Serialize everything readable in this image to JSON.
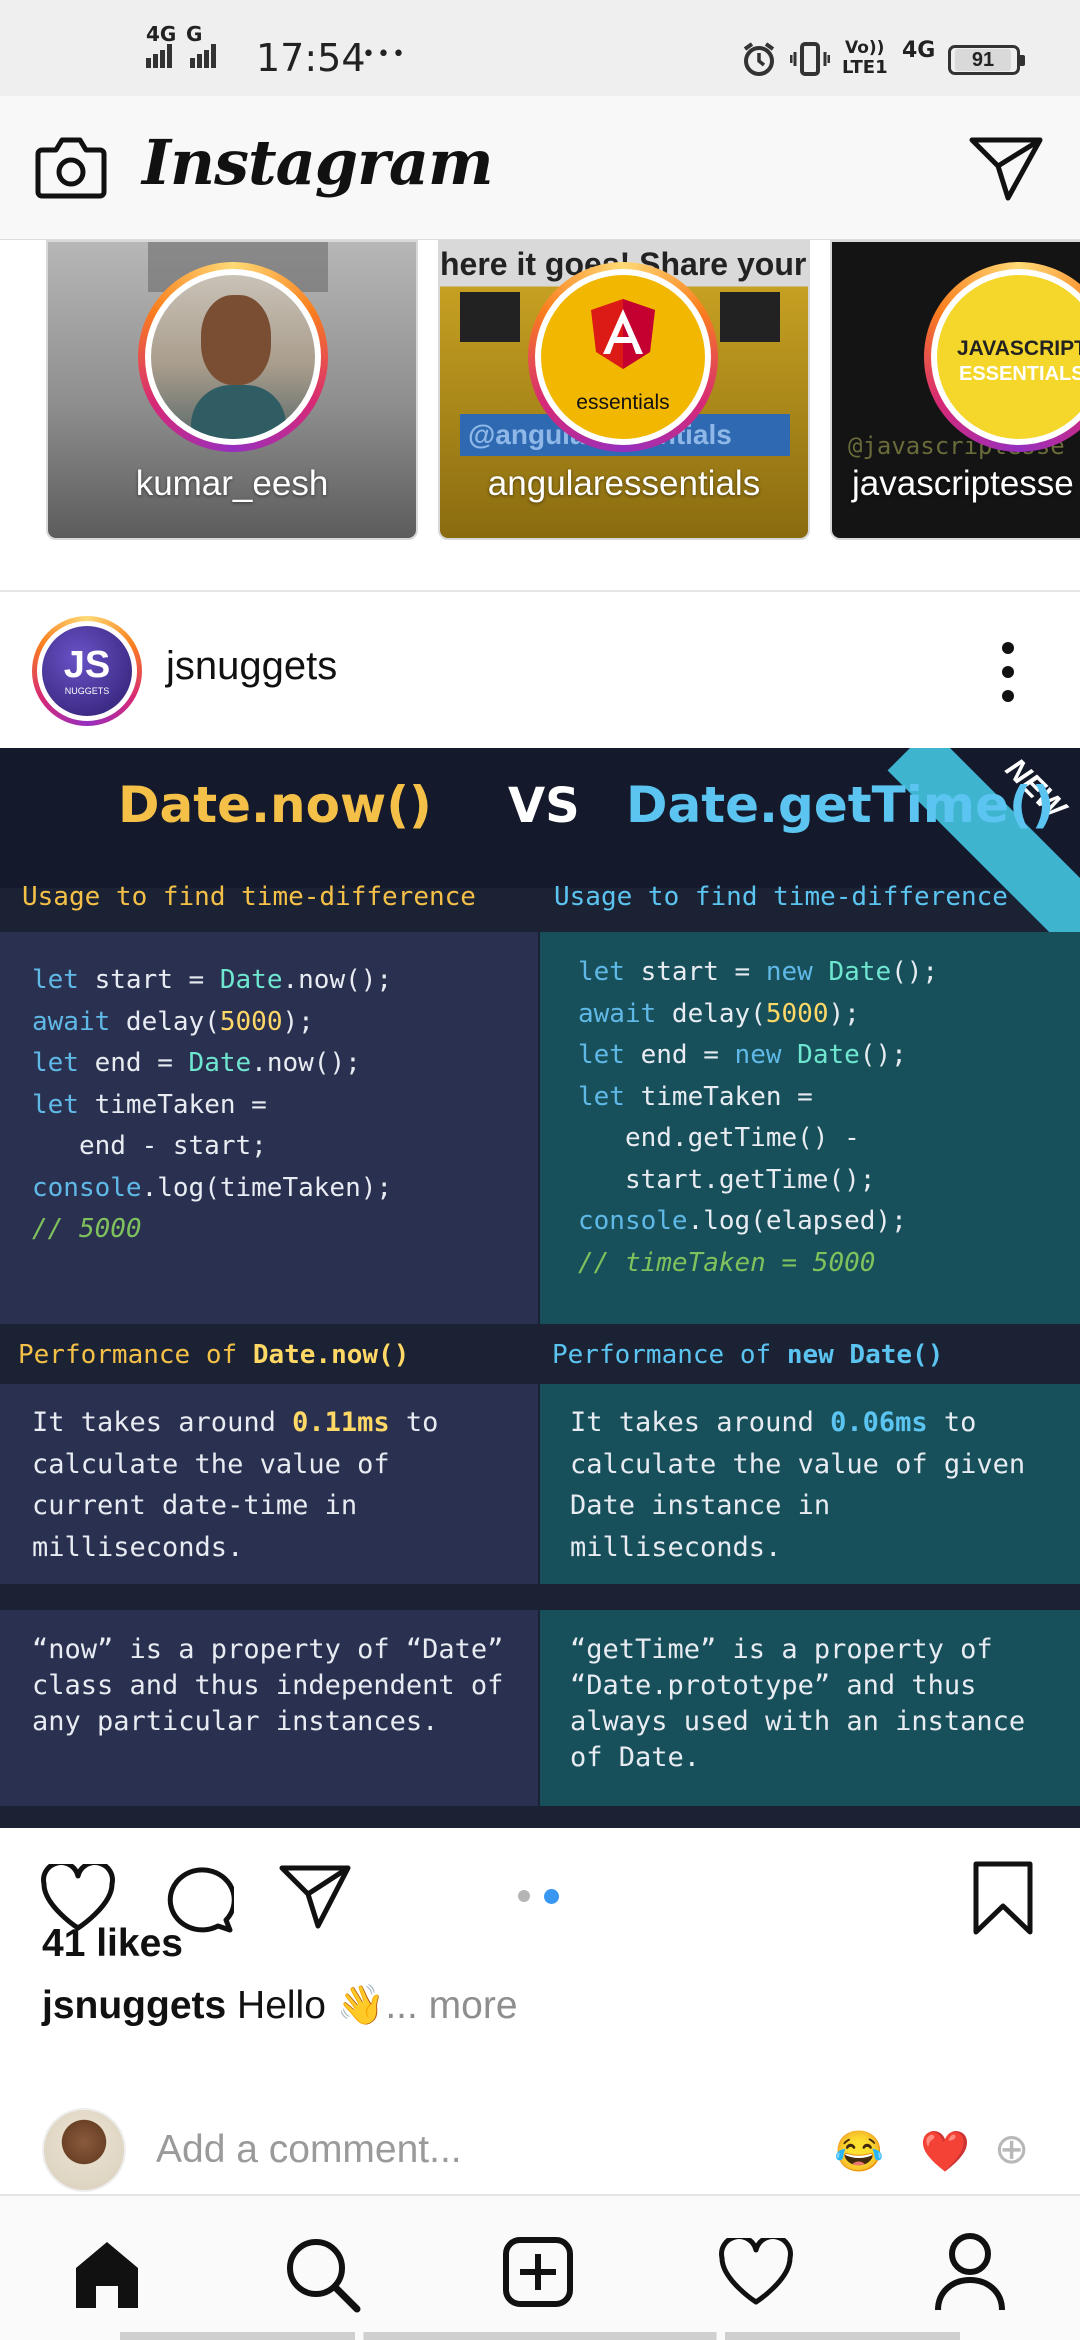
{
  "status_bar": {
    "net1": "4G",
    "net2": "G",
    "time": "17:54",
    "dots": "•••",
    "volte": "Vo))",
    "lte": "LTE1",
    "net3": "4G",
    "battery": "91"
  },
  "header": {
    "logo_text": "Instagram"
  },
  "stories": [
    {
      "name": "kumar_eesh"
    },
    {
      "name": "angularessentials",
      "avatar_text": "essentials",
      "banner_text": "here it goes! Share your",
      "handle_text": "@angularessentials"
    },
    {
      "name": "javascriptesse",
      "avatar_text_1": "JAVASCRIPT",
      "avatar_text_2": "ESSENTIALS",
      "handle_text": "@javascriptesse"
    }
  ],
  "post": {
    "username": "jsnuggets",
    "avatar_text_1": "JS",
    "avatar_text_2": "NUGGETS",
    "image": {
      "badge": "NEW",
      "title_left": "Date.now()",
      "vs": "VS",
      "title_right": "Date.getTime()",
      "usage_left": "Usage to find time-difference",
      "usage_right": "Usage to find time-difference",
      "perf_left_prefix": "Performance of ",
      "perf_left_bold": "Date.now()",
      "perf_right_prefix": "Performance of ",
      "perf_right_kw": "new",
      "perf_right_bold": " Date()",
      "perf_left_text": [
        "It takes around ",
        "0.11ms",
        " to",
        "calculate the value of",
        "current date-time in",
        "milliseconds."
      ],
      "perf_right_text": [
        "It takes around ",
        "0.06ms",
        " to",
        "calculate the value of given",
        "Date instance in",
        "milliseconds."
      ],
      "note_left": [
        "“now” is a property of “Date”",
        "class and thus independent of",
        "any particular instances."
      ],
      "note_right": [
        "“getTime” is a property of",
        "“Date.prototype” and thus",
        "always used with an instance",
        "of Date."
      ]
    },
    "likes": "41 likes",
    "caption_user": "jsnuggets",
    "caption_text": "Hello",
    "caption_emoji": "👋",
    "caption_more": "... more",
    "comment_placeholder": "Add a comment...",
    "quick_emoji_1": "😂",
    "quick_emoji_2": "❤️",
    "quick_emoji_3": "⊕",
    "carousel_active_index": 1,
    "carousel_count": 2
  },
  "colors": {
    "accent_blue": "#3897f0",
    "title_yellow": "#f4c048",
    "title_blue": "#5cc4f0",
    "code_panel_left": "#2a3150",
    "code_panel_right": "#17505a",
    "badge_teal": "#3fb4cf"
  },
  "icons": [
    "camera-icon",
    "direct-message-icon",
    "more-options-icon",
    "heart-icon",
    "comment-icon",
    "share-icon",
    "bookmark-icon",
    "home-icon",
    "search-icon",
    "add-post-icon",
    "activity-icon",
    "profile-icon"
  ]
}
